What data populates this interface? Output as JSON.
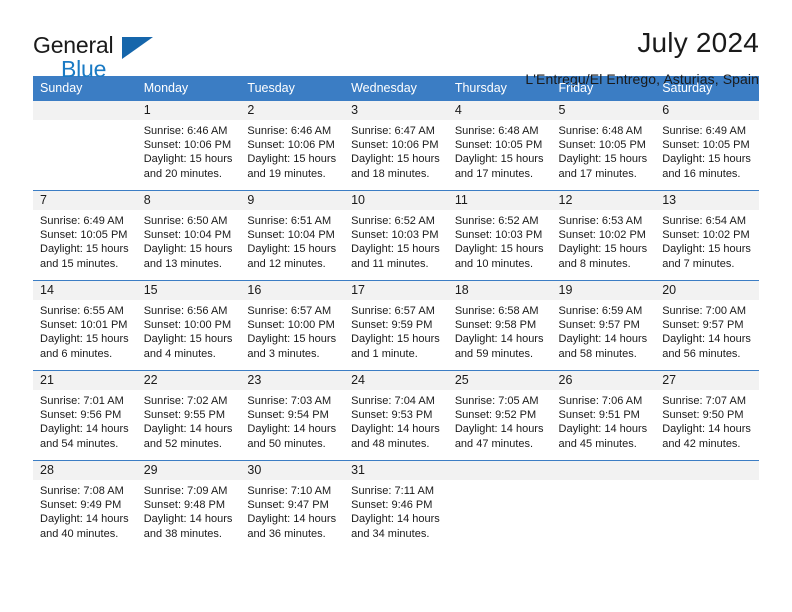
{
  "brand": {
    "word_top": "General",
    "word_bottom": "Blue",
    "triangle_color": "#1666ab",
    "blue_text_color": "#1a7ac4"
  },
  "header": {
    "title": "July 2024",
    "subtitle": "L'Entregu/El Entrego, Asturias, Spain"
  },
  "theme": {
    "header_blue": "#3b7dc4",
    "daynum_band": "#f2f2f2",
    "text": "#1a1a1a"
  },
  "weekdays": [
    "Sunday",
    "Monday",
    "Tuesday",
    "Wednesday",
    "Thursday",
    "Friday",
    "Saturday"
  ],
  "labels": {
    "sunrise_prefix": "Sunrise:",
    "sunset_prefix": "Sunset:",
    "daylight_prefix": "Daylight:"
  },
  "weeks": [
    [
      {
        "day": "",
        "sunrise": "",
        "sunset": "",
        "daylight_l1": "",
        "daylight_l2": ""
      },
      {
        "day": "1",
        "sunrise": "Sunrise: 6:46 AM",
        "sunset": "Sunset: 10:06 PM",
        "daylight_l1": "Daylight: 15 hours",
        "daylight_l2": "and 20 minutes."
      },
      {
        "day": "2",
        "sunrise": "Sunrise: 6:46 AM",
        "sunset": "Sunset: 10:06 PM",
        "daylight_l1": "Daylight: 15 hours",
        "daylight_l2": "and 19 minutes."
      },
      {
        "day": "3",
        "sunrise": "Sunrise: 6:47 AM",
        "sunset": "Sunset: 10:06 PM",
        "daylight_l1": "Daylight: 15 hours",
        "daylight_l2": "and 18 minutes."
      },
      {
        "day": "4",
        "sunrise": "Sunrise: 6:48 AM",
        "sunset": "Sunset: 10:05 PM",
        "daylight_l1": "Daylight: 15 hours",
        "daylight_l2": "and 17 minutes."
      },
      {
        "day": "5",
        "sunrise": "Sunrise: 6:48 AM",
        "sunset": "Sunset: 10:05 PM",
        "daylight_l1": "Daylight: 15 hours",
        "daylight_l2": "and 17 minutes."
      },
      {
        "day": "6",
        "sunrise": "Sunrise: 6:49 AM",
        "sunset": "Sunset: 10:05 PM",
        "daylight_l1": "Daylight: 15 hours",
        "daylight_l2": "and 16 minutes."
      }
    ],
    [
      {
        "day": "7",
        "sunrise": "Sunrise: 6:49 AM",
        "sunset": "Sunset: 10:05 PM",
        "daylight_l1": "Daylight: 15 hours",
        "daylight_l2": "and 15 minutes."
      },
      {
        "day": "8",
        "sunrise": "Sunrise: 6:50 AM",
        "sunset": "Sunset: 10:04 PM",
        "daylight_l1": "Daylight: 15 hours",
        "daylight_l2": "and 13 minutes."
      },
      {
        "day": "9",
        "sunrise": "Sunrise: 6:51 AM",
        "sunset": "Sunset: 10:04 PM",
        "daylight_l1": "Daylight: 15 hours",
        "daylight_l2": "and 12 minutes."
      },
      {
        "day": "10",
        "sunrise": "Sunrise: 6:52 AM",
        "sunset": "Sunset: 10:03 PM",
        "daylight_l1": "Daylight: 15 hours",
        "daylight_l2": "and 11 minutes."
      },
      {
        "day": "11",
        "sunrise": "Sunrise: 6:52 AM",
        "sunset": "Sunset: 10:03 PM",
        "daylight_l1": "Daylight: 15 hours",
        "daylight_l2": "and 10 minutes."
      },
      {
        "day": "12",
        "sunrise": "Sunrise: 6:53 AM",
        "sunset": "Sunset: 10:02 PM",
        "daylight_l1": "Daylight: 15 hours",
        "daylight_l2": "and 8 minutes."
      },
      {
        "day": "13",
        "sunrise": "Sunrise: 6:54 AM",
        "sunset": "Sunset: 10:02 PM",
        "daylight_l1": "Daylight: 15 hours",
        "daylight_l2": "and 7 minutes."
      }
    ],
    [
      {
        "day": "14",
        "sunrise": "Sunrise: 6:55 AM",
        "sunset": "Sunset: 10:01 PM",
        "daylight_l1": "Daylight: 15 hours",
        "daylight_l2": "and 6 minutes."
      },
      {
        "day": "15",
        "sunrise": "Sunrise: 6:56 AM",
        "sunset": "Sunset: 10:00 PM",
        "daylight_l1": "Daylight: 15 hours",
        "daylight_l2": "and 4 minutes."
      },
      {
        "day": "16",
        "sunrise": "Sunrise: 6:57 AM",
        "sunset": "Sunset: 10:00 PM",
        "daylight_l1": "Daylight: 15 hours",
        "daylight_l2": "and 3 minutes."
      },
      {
        "day": "17",
        "sunrise": "Sunrise: 6:57 AM",
        "sunset": "Sunset: 9:59 PM",
        "daylight_l1": "Daylight: 15 hours",
        "daylight_l2": "and 1 minute."
      },
      {
        "day": "18",
        "sunrise": "Sunrise: 6:58 AM",
        "sunset": "Sunset: 9:58 PM",
        "daylight_l1": "Daylight: 14 hours",
        "daylight_l2": "and 59 minutes."
      },
      {
        "day": "19",
        "sunrise": "Sunrise: 6:59 AM",
        "sunset": "Sunset: 9:57 PM",
        "daylight_l1": "Daylight: 14 hours",
        "daylight_l2": "and 58 minutes."
      },
      {
        "day": "20",
        "sunrise": "Sunrise: 7:00 AM",
        "sunset": "Sunset: 9:57 PM",
        "daylight_l1": "Daylight: 14 hours",
        "daylight_l2": "and 56 minutes."
      }
    ],
    [
      {
        "day": "21",
        "sunrise": "Sunrise: 7:01 AM",
        "sunset": "Sunset: 9:56 PM",
        "daylight_l1": "Daylight: 14 hours",
        "daylight_l2": "and 54 minutes."
      },
      {
        "day": "22",
        "sunrise": "Sunrise: 7:02 AM",
        "sunset": "Sunset: 9:55 PM",
        "daylight_l1": "Daylight: 14 hours",
        "daylight_l2": "and 52 minutes."
      },
      {
        "day": "23",
        "sunrise": "Sunrise: 7:03 AM",
        "sunset": "Sunset: 9:54 PM",
        "daylight_l1": "Daylight: 14 hours",
        "daylight_l2": "and 50 minutes."
      },
      {
        "day": "24",
        "sunrise": "Sunrise: 7:04 AM",
        "sunset": "Sunset: 9:53 PM",
        "daylight_l1": "Daylight: 14 hours",
        "daylight_l2": "and 48 minutes."
      },
      {
        "day": "25",
        "sunrise": "Sunrise: 7:05 AM",
        "sunset": "Sunset: 9:52 PM",
        "daylight_l1": "Daylight: 14 hours",
        "daylight_l2": "and 47 minutes."
      },
      {
        "day": "26",
        "sunrise": "Sunrise: 7:06 AM",
        "sunset": "Sunset: 9:51 PM",
        "daylight_l1": "Daylight: 14 hours",
        "daylight_l2": "and 45 minutes."
      },
      {
        "day": "27",
        "sunrise": "Sunrise: 7:07 AM",
        "sunset": "Sunset: 9:50 PM",
        "daylight_l1": "Daylight: 14 hours",
        "daylight_l2": "and 42 minutes."
      }
    ],
    [
      {
        "day": "28",
        "sunrise": "Sunrise: 7:08 AM",
        "sunset": "Sunset: 9:49 PM",
        "daylight_l1": "Daylight: 14 hours",
        "daylight_l2": "and 40 minutes."
      },
      {
        "day": "29",
        "sunrise": "Sunrise: 7:09 AM",
        "sunset": "Sunset: 9:48 PM",
        "daylight_l1": "Daylight: 14 hours",
        "daylight_l2": "and 38 minutes."
      },
      {
        "day": "30",
        "sunrise": "Sunrise: 7:10 AM",
        "sunset": "Sunset: 9:47 PM",
        "daylight_l1": "Daylight: 14 hours",
        "daylight_l2": "and 36 minutes."
      },
      {
        "day": "31",
        "sunrise": "Sunrise: 7:11 AM",
        "sunset": "Sunset: 9:46 PM",
        "daylight_l1": "Daylight: 14 hours",
        "daylight_l2": "and 34 minutes."
      },
      {
        "day": "",
        "sunrise": "",
        "sunset": "",
        "daylight_l1": "",
        "daylight_l2": ""
      },
      {
        "day": "",
        "sunrise": "",
        "sunset": "",
        "daylight_l1": "",
        "daylight_l2": ""
      },
      {
        "day": "",
        "sunrise": "",
        "sunset": "",
        "daylight_l1": "",
        "daylight_l2": ""
      }
    ]
  ]
}
